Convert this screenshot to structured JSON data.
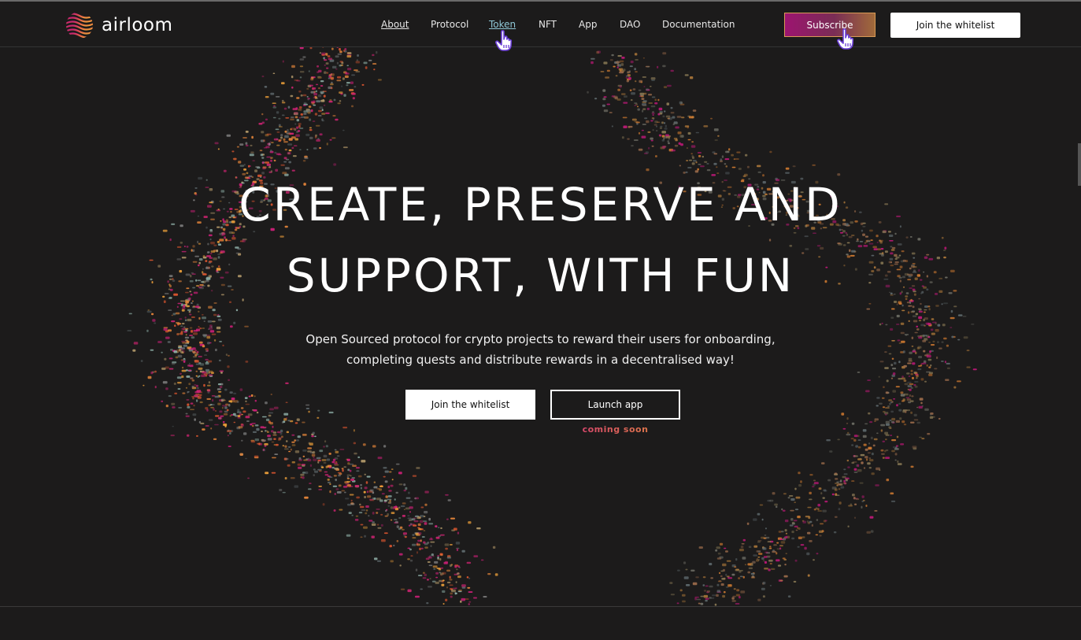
{
  "brand": {
    "name": "airloom"
  },
  "nav": {
    "items": [
      {
        "label": "About"
      },
      {
        "label": "Protocol"
      },
      {
        "label": "Token"
      },
      {
        "label": "NFT"
      },
      {
        "label": "App"
      },
      {
        "label": "DAO"
      },
      {
        "label": "Documentation"
      }
    ],
    "subscribe_label": "Subscribe",
    "whitelist_label": "Join the whitelist"
  },
  "hero": {
    "title_line1": "CREATE, PRESERVE AND",
    "title_line2": "SUPPORT, WITH FUN",
    "subtitle_line1": "Open Sourced protocol for crypto projects to reward their users for onboarding,",
    "subtitle_line2": "completing quests and distribute rewards in a decentralised way!",
    "primary_button": "Join the whitelist",
    "secondary_button": "Launch app",
    "secondary_note": "coming soon"
  },
  "colors": {
    "background": "#1c1b1b",
    "accent_magenta": "#d41f7c",
    "accent_orange": "#e8873a",
    "active_link": "#8fc7d6"
  },
  "icons": {
    "cursor": "hand-pointer-icon",
    "logo": "airloom-wave-logo-icon"
  }
}
